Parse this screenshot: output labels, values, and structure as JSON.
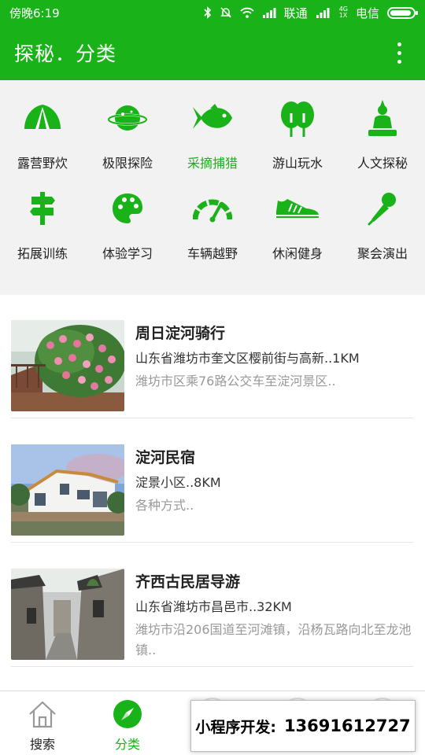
{
  "colors": {
    "brand_green": "#19b319",
    "panel_bg": "#f2f2f2",
    "muted_text": "#999999"
  },
  "status_bar": {
    "time": "傍晚6:19",
    "carrier1": "联通",
    "carrier2": "电信",
    "network": "4G",
    "network2": "1X"
  },
  "app_bar": {
    "title": "探秘．分类",
    "menu_icon": "more-vertical-icon"
  },
  "categories": [
    {
      "label": "露营野炊",
      "icon": "tent-icon"
    },
    {
      "label": "极限探险",
      "icon": "planet-icon"
    },
    {
      "label": "采摘捕猎",
      "icon": "fish-icon",
      "selected": true
    },
    {
      "label": "游山玩水",
      "icon": "trees-icon"
    },
    {
      "label": "人文探秘",
      "icon": "buddha-icon"
    },
    {
      "label": "拓展训练",
      "icon": "signpost-icon"
    },
    {
      "label": "体验学习",
      "icon": "palette-icon"
    },
    {
      "label": "车辆越野",
      "icon": "speedometer-icon"
    },
    {
      "label": "休闲健身",
      "icon": "sneaker-icon"
    },
    {
      "label": "聚会演出",
      "icon": "microphone-icon"
    }
  ],
  "listings": [
    {
      "name": "周日淀河骑行",
      "address": "山东省潍坊市奎文区樱前街与高新..1KM",
      "route": "潍坊市区乘76路公交车至淀河景区..",
      "image": "rose-garden-photo"
    },
    {
      "name": "淀河民宿",
      "address": "淀景小区..8KM",
      "route": "各种方式..",
      "image": "villa-photo"
    },
    {
      "name": "齐西古民居导游",
      "address": "山东省潍坊市昌邑市..32KM",
      "route": "潍坊市沿206国道至河滩镇，沿杨瓦路向北至龙池镇..",
      "image": "old-alley-photo"
    }
  ],
  "tab_bar": {
    "tabs": [
      {
        "label": "搜索",
        "icon": "home-icon"
      },
      {
        "label": "分类",
        "icon": "compass-icon",
        "selected": true
      }
    ]
  },
  "promo": {
    "label": "小程序开发:",
    "phone": "13691612727"
  }
}
